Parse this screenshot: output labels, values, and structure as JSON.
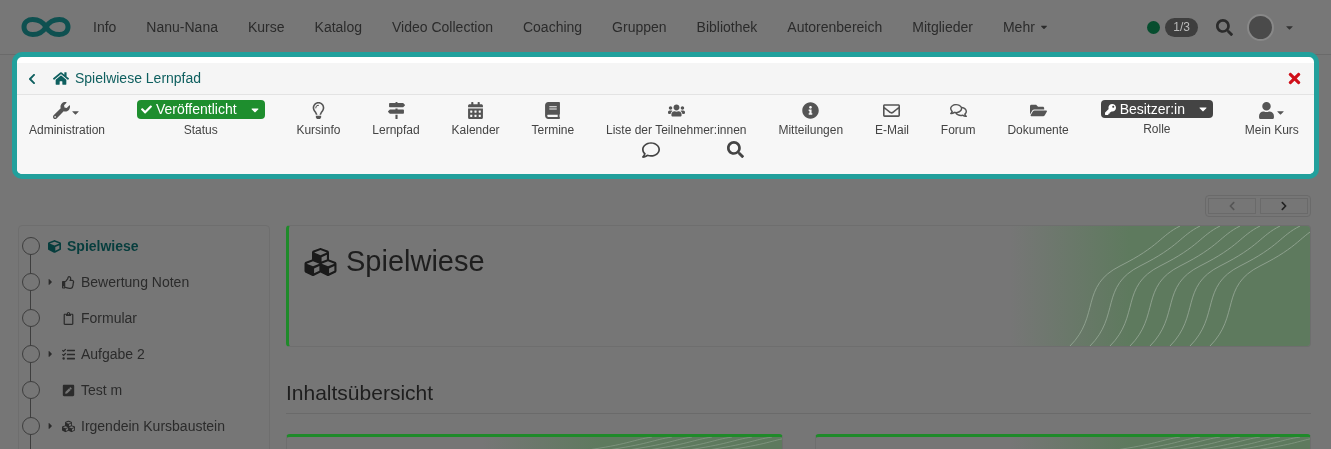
{
  "nav": {
    "items": [
      {
        "label": "Info"
      },
      {
        "label": "Nanu-Nana"
      },
      {
        "label": "Kurse"
      },
      {
        "label": "Katalog"
      },
      {
        "label": "Video Collection"
      },
      {
        "label": "Coaching"
      },
      {
        "label": "Gruppen"
      },
      {
        "label": "Bibliothek"
      },
      {
        "label": "Autorenbereich"
      },
      {
        "label": "Mitglieder"
      }
    ],
    "more": "Mehr",
    "counter": "1/3"
  },
  "course_toolbar": {
    "title": "Spielwiese Lernpfad",
    "tools": [
      {
        "kind": "menu",
        "label": "Administration"
      },
      {
        "kind": "status",
        "value": "Veröffentlicht",
        "label": "Status"
      },
      {
        "kind": "tool",
        "label": "Kursinfo"
      },
      {
        "kind": "tool",
        "label": "Lernpfad"
      },
      {
        "kind": "tool",
        "label": "Kalender"
      },
      {
        "kind": "tool",
        "label": "Termine"
      },
      {
        "kind": "tool",
        "label": "Liste der Teilnehmer:innen"
      },
      {
        "kind": "tool",
        "label": "Mitteilungen"
      },
      {
        "kind": "tool",
        "label": "E-Mail"
      },
      {
        "kind": "tool",
        "label": "Forum"
      },
      {
        "kind": "tool",
        "label": "Dokumente"
      },
      {
        "kind": "role",
        "value": "Besitzer:in",
        "label": "Rolle"
      },
      {
        "kind": "menu",
        "label": "Mein Kurs"
      }
    ]
  },
  "course_tree": {
    "label": "Spielwiese",
    "selected": true,
    "children": [
      {
        "label": "Bewertung Noten",
        "selected": false,
        "has_children": true
      },
      {
        "label": "Formular",
        "selected": false,
        "has_children": false
      },
      {
        "label": "Aufgabe 2",
        "selected": false,
        "has_children": true
      },
      {
        "label": "Test m",
        "selected": false,
        "has_children": false
      },
      {
        "label": "Irgendein Kursbaustein",
        "selected": false,
        "has_children": true
      }
    ]
  },
  "main": {
    "title": "Spielwiese",
    "section_heading": "Inhaltsübersicht"
  }
}
